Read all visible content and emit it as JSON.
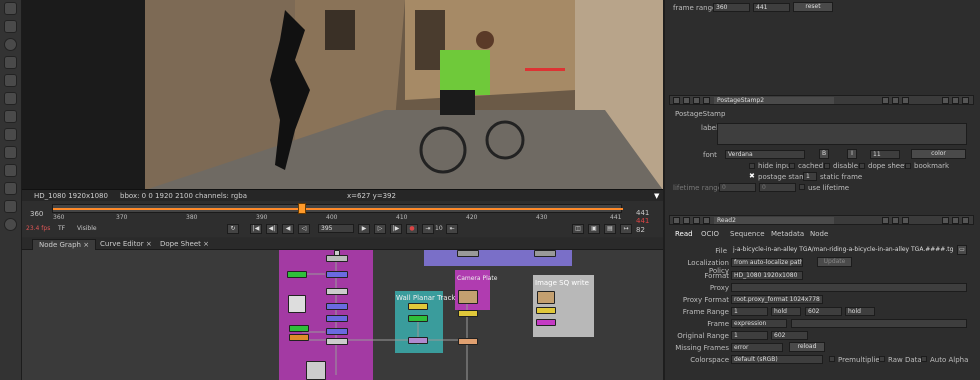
{
  "viewer": {
    "format_info": "HD_1080 1920x1080",
    "bbox_info": "bbox: 0 0 1920 2100 channels: rgba",
    "coords": "x=627 y=392"
  },
  "timeline": {
    "start": "360",
    "end": "441",
    "current": "395",
    "fps": "23.4 fps",
    "tf": "TF",
    "visible": "Visible",
    "ticks": [
      "360",
      "370",
      "380",
      "390",
      "400",
      "410",
      "420",
      "430",
      "441"
    ],
    "frame_field": "395",
    "step": "10",
    "end_field": "82",
    "range_start": "360",
    "range_end": "441"
  },
  "tabs": {
    "node_graph": "Node Graph",
    "curve_editor": "Curve Editor",
    "dope_sheet": "Dope Sheet"
  },
  "graph": {
    "wall_tracker": "Wall Planar Tracker",
    "camera_plate": "Camera Plate",
    "image_sq_write": "Image SQ write"
  },
  "top_panel": {
    "frame_range_label": "frame range",
    "fr_start": "360",
    "fr_end": "441",
    "reset": "reset"
  },
  "postage": {
    "name": "PostageStamp2",
    "class_label": "PostageStamp",
    "label_label": "label",
    "font_label": "font",
    "font_value": "Verdana",
    "font_size": "11",
    "color_btn": "color",
    "hide_input": "hide input",
    "cached": "cached",
    "disable": "disable",
    "dope_sheet": "dope sheet",
    "bookmark": "bookmark",
    "postage_stamp": "postage stamp",
    "static_value": "1",
    "static_frame": "static frame",
    "lifetime_range_label": "lifetime range",
    "lt_start": "0",
    "lt_end": "0",
    "use_lifetime": "use lifetime"
  },
  "read": {
    "name": "Read2",
    "tabs": [
      "Read",
      "OCIO",
      "Sequence",
      "Metadata",
      "Node"
    ],
    "file_label": "File",
    "file_value": "j-a-bicycle-in-an-alley TGA/man-riding-a-bicycle-in-an-alley TGA.####.tga",
    "loc_policy_label": "Localization Policy",
    "loc_policy_value": "from auto-localize path",
    "update": "Update",
    "format_label": "Format",
    "format_value": "HD_1080 1920x1080",
    "proxy_label": "Proxy",
    "proxy_format_label": "Proxy Format",
    "proxy_format_value": "root.proxy_format 1024x778",
    "frame_range_label": "Frame Range",
    "fr_start": "1",
    "fr_before": "hold",
    "fr_end": "602",
    "fr_after": "hold",
    "frame_label": "Frame",
    "frame_value": "expression",
    "original_range_label": "Original Range",
    "or_start": "1",
    "or_end": "602",
    "missing_label": "Missing Frames",
    "missing_value": "error",
    "reload": "reload",
    "colorspace_label": "Colorspace",
    "colorspace_value": "default (sRGB)",
    "premultiplied": "Premultiplied",
    "raw_data": "Raw Data",
    "auto_alpha": "Auto Alpha"
  }
}
